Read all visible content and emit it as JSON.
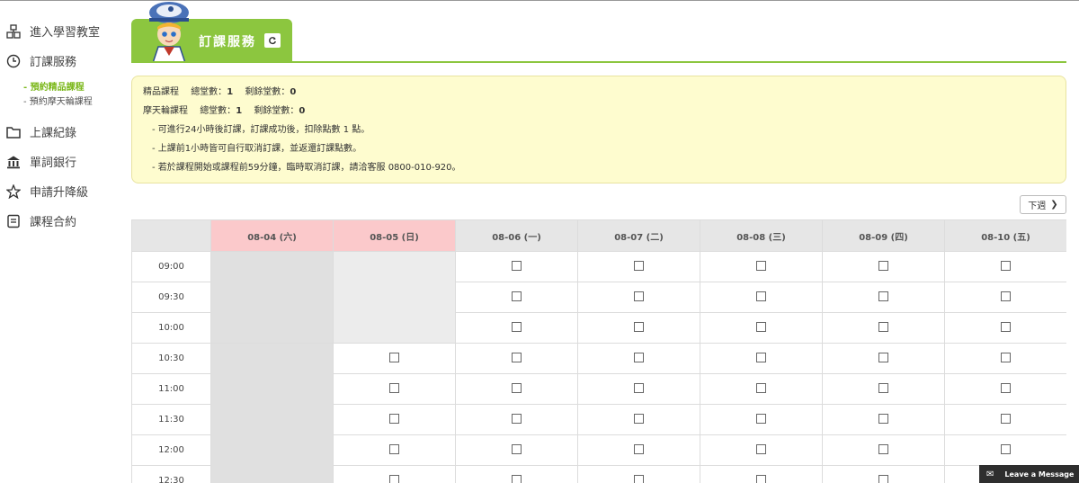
{
  "sidebar": {
    "items": [
      {
        "icon": "classroom-icon",
        "label": "進入學習教室"
      },
      {
        "icon": "clock-icon",
        "label": "訂課服務"
      },
      {
        "icon": "folder-icon",
        "label": "上課紀錄"
      },
      {
        "icon": "bank-icon",
        "label": "單詞銀行"
      },
      {
        "icon": "star-icon",
        "label": "申請升降級"
      },
      {
        "icon": "document-icon",
        "label": "課程合約"
      }
    ],
    "sub_items": [
      {
        "label": "- 預約精品課程",
        "active": true
      },
      {
        "label": "- 預約摩天輪課程",
        "active": false
      }
    ]
  },
  "header": {
    "title": "訂課服務",
    "refresh_icon": "refresh-icon",
    "accent": "#8cc63f"
  },
  "info": {
    "rows": [
      {
        "name": "精品課程",
        "total_label": "總堂數：",
        "total": "1",
        "remain_label": "剩餘堂數：",
        "remain": "0"
      },
      {
        "name": "摩天輪課程",
        "total_label": "總堂數：",
        "total": "1",
        "remain_label": "剩餘堂數：",
        "remain": "0"
      }
    ],
    "notes": [
      "- 可進行24小時後訂課，訂課成功後，扣除點數 1 點。",
      "- 上課前1小時皆可自行取消訂課，並返還訂課點數。",
      "- 若於課程開始或課程前59分鐘，臨時取消訂課，請洽客服 0800-010-920。"
    ]
  },
  "next_week_label": "下週",
  "schedule": {
    "days": [
      "08-04 (六)",
      "08-05 (日)",
      "08-06 (一)",
      "08-07 (二)",
      "08-08 (三)",
      "08-09 (四)",
      "08-10 (五)"
    ],
    "times": [
      "09:00",
      "09:30",
      "10:00",
      "10:30",
      "11:00",
      "11:30",
      "12:00",
      "12:30"
    ]
  },
  "leave_message": "Leave a Message"
}
